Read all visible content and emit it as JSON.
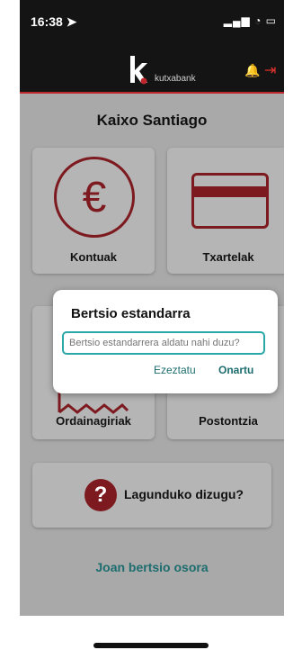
{
  "status_bar": {
    "time": "16:38 ➤",
    "icons": "▂▄▆ ◔ ▭"
  },
  "header": {
    "logo_text": "kutxabank",
    "bell_icon": "bell-icon",
    "exit_icon": "exit-icon"
  },
  "greeting": "Kaixo Santiago",
  "tiles": [
    {
      "label": "Kontuak",
      "icon": "euro-icon"
    },
    {
      "label": "Txartelak",
      "icon": "card-icon"
    },
    {
      "label": "Ordainagiriak",
      "icon": "receipt-icon"
    },
    {
      "label": "Postontzia",
      "icon": "mailbox-icon"
    }
  ],
  "help": {
    "label": "Lagunduko dizugu?",
    "icon": "question-icon"
  },
  "link": "Joan bertsio osora",
  "dialog": {
    "title": "Bertsio estandarra",
    "field_placeholder": "Bertsio estandarrera aldatu nahi duzu?",
    "cancel": "Ezeztatu",
    "ok": "Onartu"
  },
  "colors": {
    "brand_red": "#c0272d",
    "icon_maroon": "#7d1a1f",
    "teal": "#2aa8a8"
  }
}
